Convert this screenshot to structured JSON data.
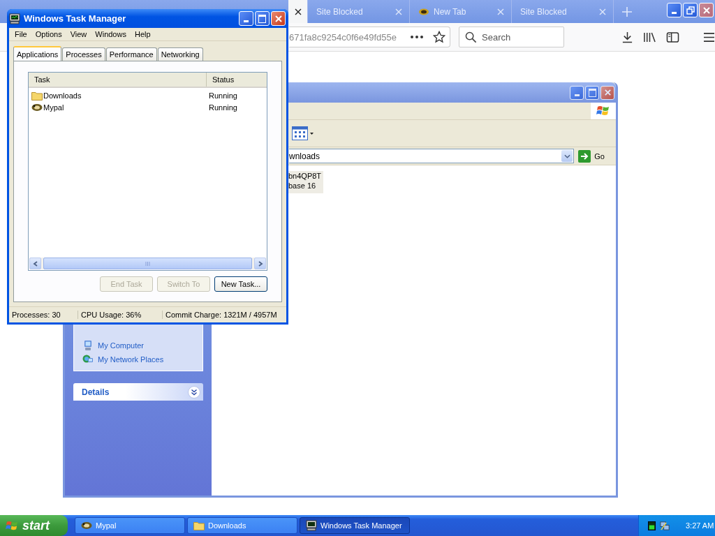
{
  "browser": {
    "tabs": [
      {
        "selected": true,
        "favicon": false
      },
      {
        "label": "Site Blocked",
        "selected": false,
        "favicon": false
      },
      {
        "label": "New Tab",
        "selected": false,
        "favicon": true
      },
      {
        "label": "Site Blocked",
        "selected": false,
        "favicon": false
      }
    ],
    "url": "671fa8c9254c0f6e49fd55e",
    "search_placeholder": "Search"
  },
  "explorer": {
    "address": "wnloads",
    "go": "Go",
    "file_lines": [
      "bn4QP8T",
      "base 16"
    ],
    "places": [
      {
        "label": "My Computer",
        "kind": "computer"
      },
      {
        "label": "My Network Places",
        "kind": "network"
      }
    ],
    "details_title": "Details"
  },
  "task_manager": {
    "title": "Windows Task Manager",
    "menu": [
      "File",
      "Options",
      "View",
      "Windows",
      "Help"
    ],
    "tabs": [
      {
        "label": "Applications",
        "selected": true
      },
      {
        "label": "Processes",
        "selected": false
      },
      {
        "label": "Performance",
        "selected": false
      },
      {
        "label": "Networking",
        "selected": false
      }
    ],
    "columns": [
      "Task",
      "Status"
    ],
    "rows": [
      {
        "task": "Downloads",
        "status": "Running",
        "kind": "folder"
      },
      {
        "task": "Mypal",
        "status": "Running",
        "kind": "app"
      }
    ],
    "buttons": [
      {
        "label": "End Task",
        "disabled": true
      },
      {
        "label": "Switch To",
        "disabled": true
      },
      {
        "label": "New Task...",
        "disabled": false
      }
    ],
    "status": [
      "Processes: 30",
      "CPU Usage: 36%",
      "Commit Charge: 1321M / 4957M"
    ]
  },
  "taskbar": {
    "start": "start",
    "items": [
      {
        "label": "Mypal",
        "kind": "app",
        "selected": false
      },
      {
        "label": "Downloads",
        "kind": "folder",
        "selected": false
      },
      {
        "label": "Windows Task Manager",
        "kind": "monitor",
        "selected": true
      }
    ],
    "clock": "3:27 AM"
  }
}
